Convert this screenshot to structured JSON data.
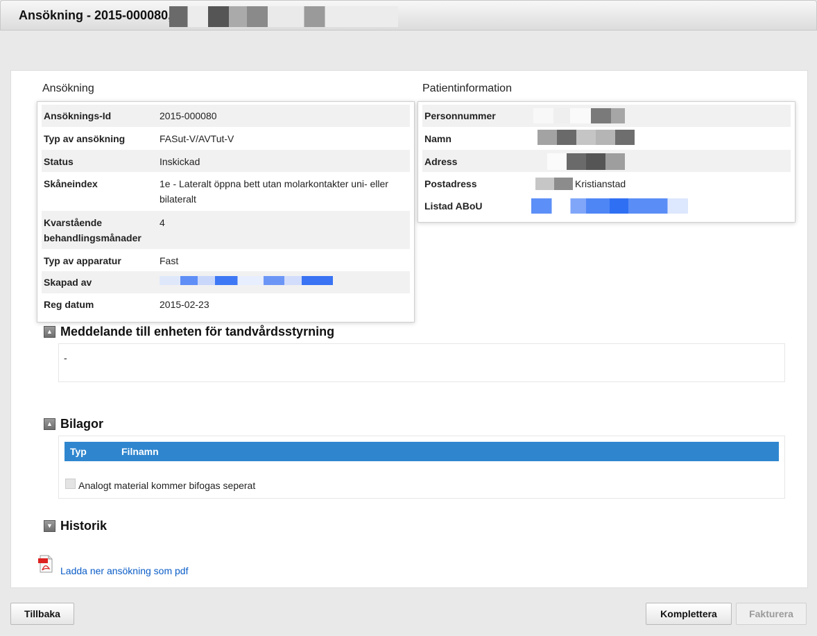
{
  "window": {
    "title": "Ansökning - 2015-000080,"
  },
  "application": {
    "heading": "Ansökning",
    "rows": [
      {
        "label": "Ansöknings-Id",
        "value": "2015-000080"
      },
      {
        "label": "Typ av ansökning",
        "value": "FASut-V/AVTut-V"
      },
      {
        "label": "Status",
        "value": "Inskickad"
      },
      {
        "label": "Skåneindex",
        "value": "1e - Lateralt öppna bett utan molarkontakter uni- eller bilateralt"
      },
      {
        "label": "Kvarstående behandlingsmånader",
        "value": "4"
      },
      {
        "label": "Typ av apparatur",
        "value": "Fast"
      },
      {
        "label": "Skapad av",
        "value": ""
      },
      {
        "label": "Reg datum",
        "value": "2015-02-23"
      }
    ]
  },
  "patient": {
    "heading": "Patientinformation",
    "rows": [
      {
        "label": "Personnummer",
        "value": ""
      },
      {
        "label": "Namn",
        "value": ""
      },
      {
        "label": "Adress",
        "value": ""
      },
      {
        "label": "Postadress",
        "value": "Kristianstad"
      },
      {
        "label": "Listad ABoU",
        "value": ""
      }
    ]
  },
  "message": {
    "heading": "Meddelande till enheten för tandvårdsstyrning",
    "text": "-"
  },
  "attachments": {
    "heading": "Bilagor",
    "columns": [
      "Typ",
      "Filnamn"
    ],
    "checkbox_label": "Analogt material kommer bifogas seperat",
    "checked": false
  },
  "history": {
    "heading": "Historik"
  },
  "download": {
    "label": "Ladda ner ansökning som pdf"
  },
  "buttons": {
    "back": "Tillbaka",
    "complete": "Komplettera",
    "invoice": "Fakturera"
  },
  "icons": {
    "expanded": "triangle-up-icon",
    "collapsed": "triangle-down-icon",
    "pdf": "pdf-icon"
  },
  "colors": {
    "table_header": "#2f86cf",
    "link": "#0a5cc7"
  }
}
